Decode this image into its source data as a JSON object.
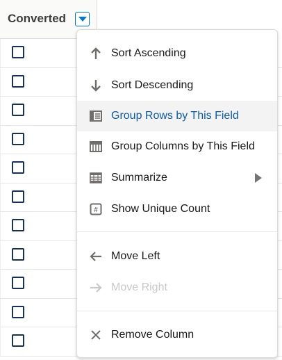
{
  "column_header": {
    "title": "Converted"
  },
  "rows": [
    {
      "checked": false
    },
    {
      "checked": false
    },
    {
      "checked": false
    },
    {
      "checked": false
    },
    {
      "checked": false
    },
    {
      "checked": false
    },
    {
      "checked": false
    },
    {
      "checked": false
    },
    {
      "checked": false
    },
    {
      "checked": false
    },
    {
      "checked": false
    }
  ],
  "menu": {
    "items": [
      {
        "label": "Sort Ascending",
        "icon": "arrow-up-icon"
      },
      {
        "label": "Sort Descending",
        "icon": "arrow-down-icon"
      },
      {
        "label": "Group Rows by This Field",
        "icon": "group-rows-icon",
        "active": true
      },
      {
        "label": "Group Columns by This Field",
        "icon": "group-columns-icon"
      },
      {
        "label": "Summarize",
        "icon": "summarize-icon",
        "has_submenu": true
      },
      {
        "label": "Show Unique Count",
        "icon": "unique-count-icon"
      },
      {
        "label": "Move Left",
        "icon": "arrow-left-icon"
      },
      {
        "label": "Move Right",
        "icon": "arrow-right-icon",
        "disabled": true
      },
      {
        "label": "Remove Column",
        "icon": "close-icon"
      }
    ]
  },
  "colors": {
    "accent": "#0176d3",
    "active_text": "#0b5cab",
    "checkbox_border": "#16325c",
    "disabled_text": "#c9c9c9"
  }
}
